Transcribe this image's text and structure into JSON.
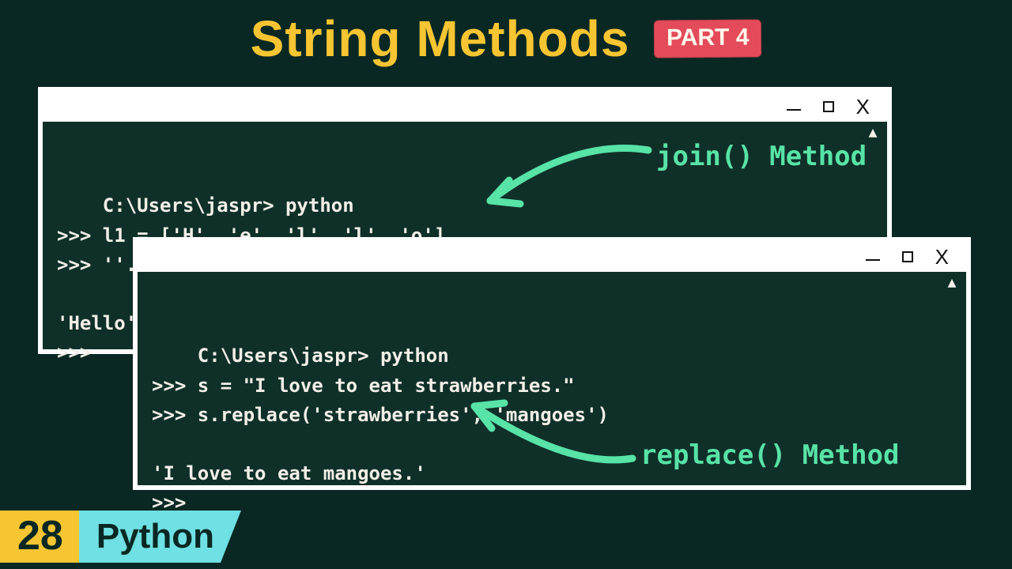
{
  "header": {
    "title": "String Methods",
    "badge": "PART 4"
  },
  "callouts": {
    "join": "join() Method",
    "replace": "replace() Method"
  },
  "terminal1": {
    "lines": "C:\\Users\\jaspr> python\n>>> l1 = ['H', 'e', 'l', 'l', 'o']\n>>> ''.join(l1)\n\n'Hello'\n>>> "
  },
  "terminal2": {
    "lines": "C:\\Users\\jaspr> python\n>>> s = \"I love to eat strawberries.\"\n>>> s.replace('strawberries', 'mangoes')\n\n'I love to eat mangoes.'\n>>> "
  },
  "footer": {
    "episode": "28",
    "language": "Python"
  }
}
